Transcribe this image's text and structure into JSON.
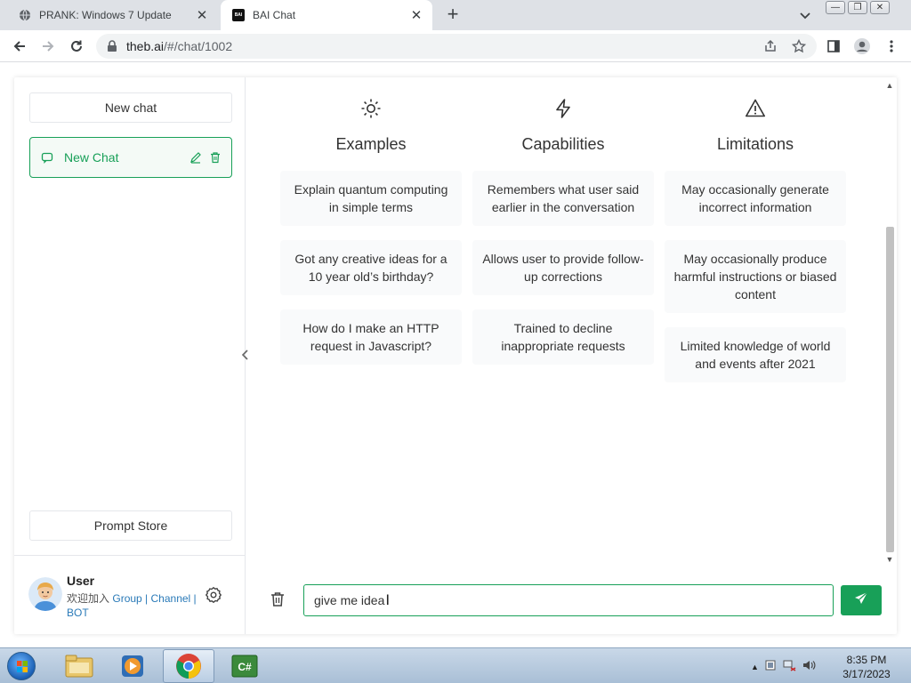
{
  "browser": {
    "tabs": [
      {
        "title": "PRANK: Windows 7 Update",
        "active": false
      },
      {
        "title": "BAI Chat",
        "active": true
      }
    ],
    "url_host": "theb.ai",
    "url_path": "/#/chat/1002",
    "window_controls": {
      "minimize": "—",
      "restore": "❐",
      "close": "✕"
    }
  },
  "sidebar": {
    "new_chat_label": "New chat",
    "chats": [
      {
        "label": "New Chat"
      }
    ],
    "prompt_store_label": "Prompt Store",
    "user": {
      "name": "User",
      "desc_prefix": "欢迎加入",
      "link_group": "Group",
      "sep1": " | ",
      "link_channel": "Channel",
      "sep2": " | ",
      "link_bot": "BOT"
    }
  },
  "main": {
    "columns": [
      {
        "title": "Examples",
        "icon": "sun-icon",
        "cards": [
          "Explain quantum computing in simple terms",
          "Got any creative ideas for a 10 year old’s birthday?",
          "How do I make an HTTP request in Javascript?"
        ]
      },
      {
        "title": "Capabilities",
        "icon": "lightning-icon",
        "cards": [
          "Remembers what user said earlier in the conversation",
          "Allows user to provide follow-up corrections",
          "Trained to decline inappropriate requests"
        ]
      },
      {
        "title": "Limitations",
        "icon": "warning-icon",
        "cards": [
          "May occasionally generate incorrect information",
          "May occasionally produce harmful instructions or biased content",
          "Limited knowledge of world and events after 2021"
        ]
      }
    ],
    "input_value": "give me idea"
  },
  "taskbar": {
    "time": "8:35 PM",
    "date": "3/17/2023"
  },
  "colors": {
    "accent": "#18a058",
    "card_bg": "#f9fafb"
  }
}
